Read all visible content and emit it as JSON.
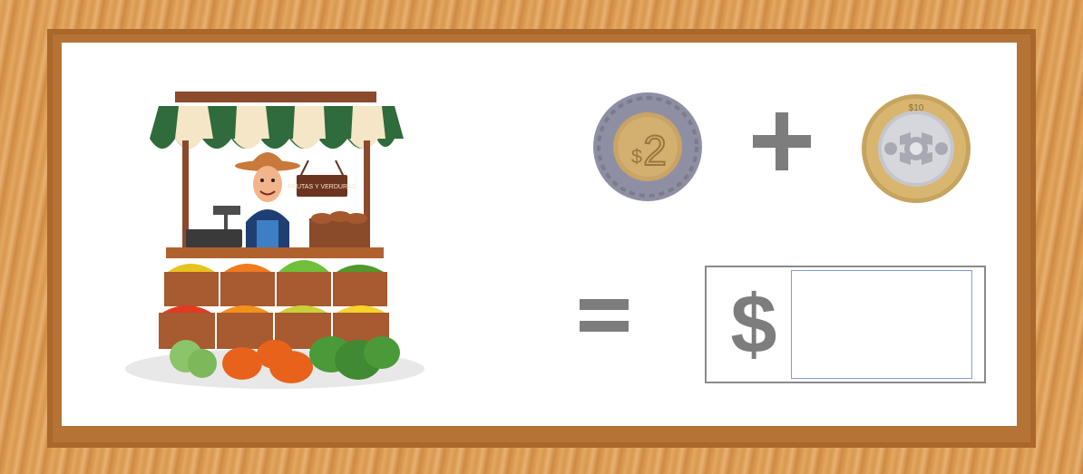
{
  "stall": {
    "sign_text": "FRUTAS Y VERDURAS"
  },
  "coins": [
    {
      "denomination": "$2",
      "icon": "peso-2-coin-icon",
      "numeral": "2",
      "currency_symbol": "$"
    },
    {
      "denomination": "$10",
      "icon": "peso-10-coin-icon",
      "label": "$10"
    }
  ],
  "operators": {
    "plus": "+",
    "equals": "="
  },
  "answer": {
    "currency_symbol": "$",
    "value": "",
    "placeholder": ""
  },
  "colors": {
    "frame_wood": "#dd9e56",
    "board": "#ffffff",
    "operator_gray": "#7d7d7d",
    "input_border": "#7a9fe0"
  }
}
